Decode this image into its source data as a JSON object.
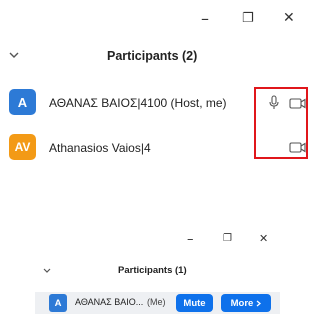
{
  "top_panel": {
    "window_controls": {
      "minimize": "–",
      "restore": "❐",
      "close": "✕"
    },
    "collapse_icon": "chevron-down-icon",
    "title": "Participants (2)",
    "participants": [
      {
        "avatar_text": "A",
        "avatar_color": "#2d7ad6",
        "name": "ΑΘΑΝΑΣ ΒΑΙΟΣ|4100 (Host, me)",
        "icons": [
          "microphone-icon",
          "video-camera-icon"
        ]
      },
      {
        "avatar_text": "AV",
        "avatar_color": "#f39a16",
        "name": "Athanasios Vaios|4",
        "icons": [
          "video-camera-icon"
        ]
      }
    ],
    "highlight_color": "#e0161b"
  },
  "bottom_panel": {
    "window_controls": {
      "minimize": "–",
      "restore": "❐",
      "close": "✕"
    },
    "collapse_icon": "chevron-down-icon",
    "title": "Participants (1)",
    "participant": {
      "avatar_text": "A",
      "avatar_color": "#2d7ad6",
      "name": "ΑΘΑΝΑΣ ΒΑΙΟ...",
      "suffix": "(Me)"
    },
    "mute_label": "Mute",
    "more_label": "More",
    "more_icon": "chevron-right-icon",
    "button_color": "#0e71eb"
  }
}
